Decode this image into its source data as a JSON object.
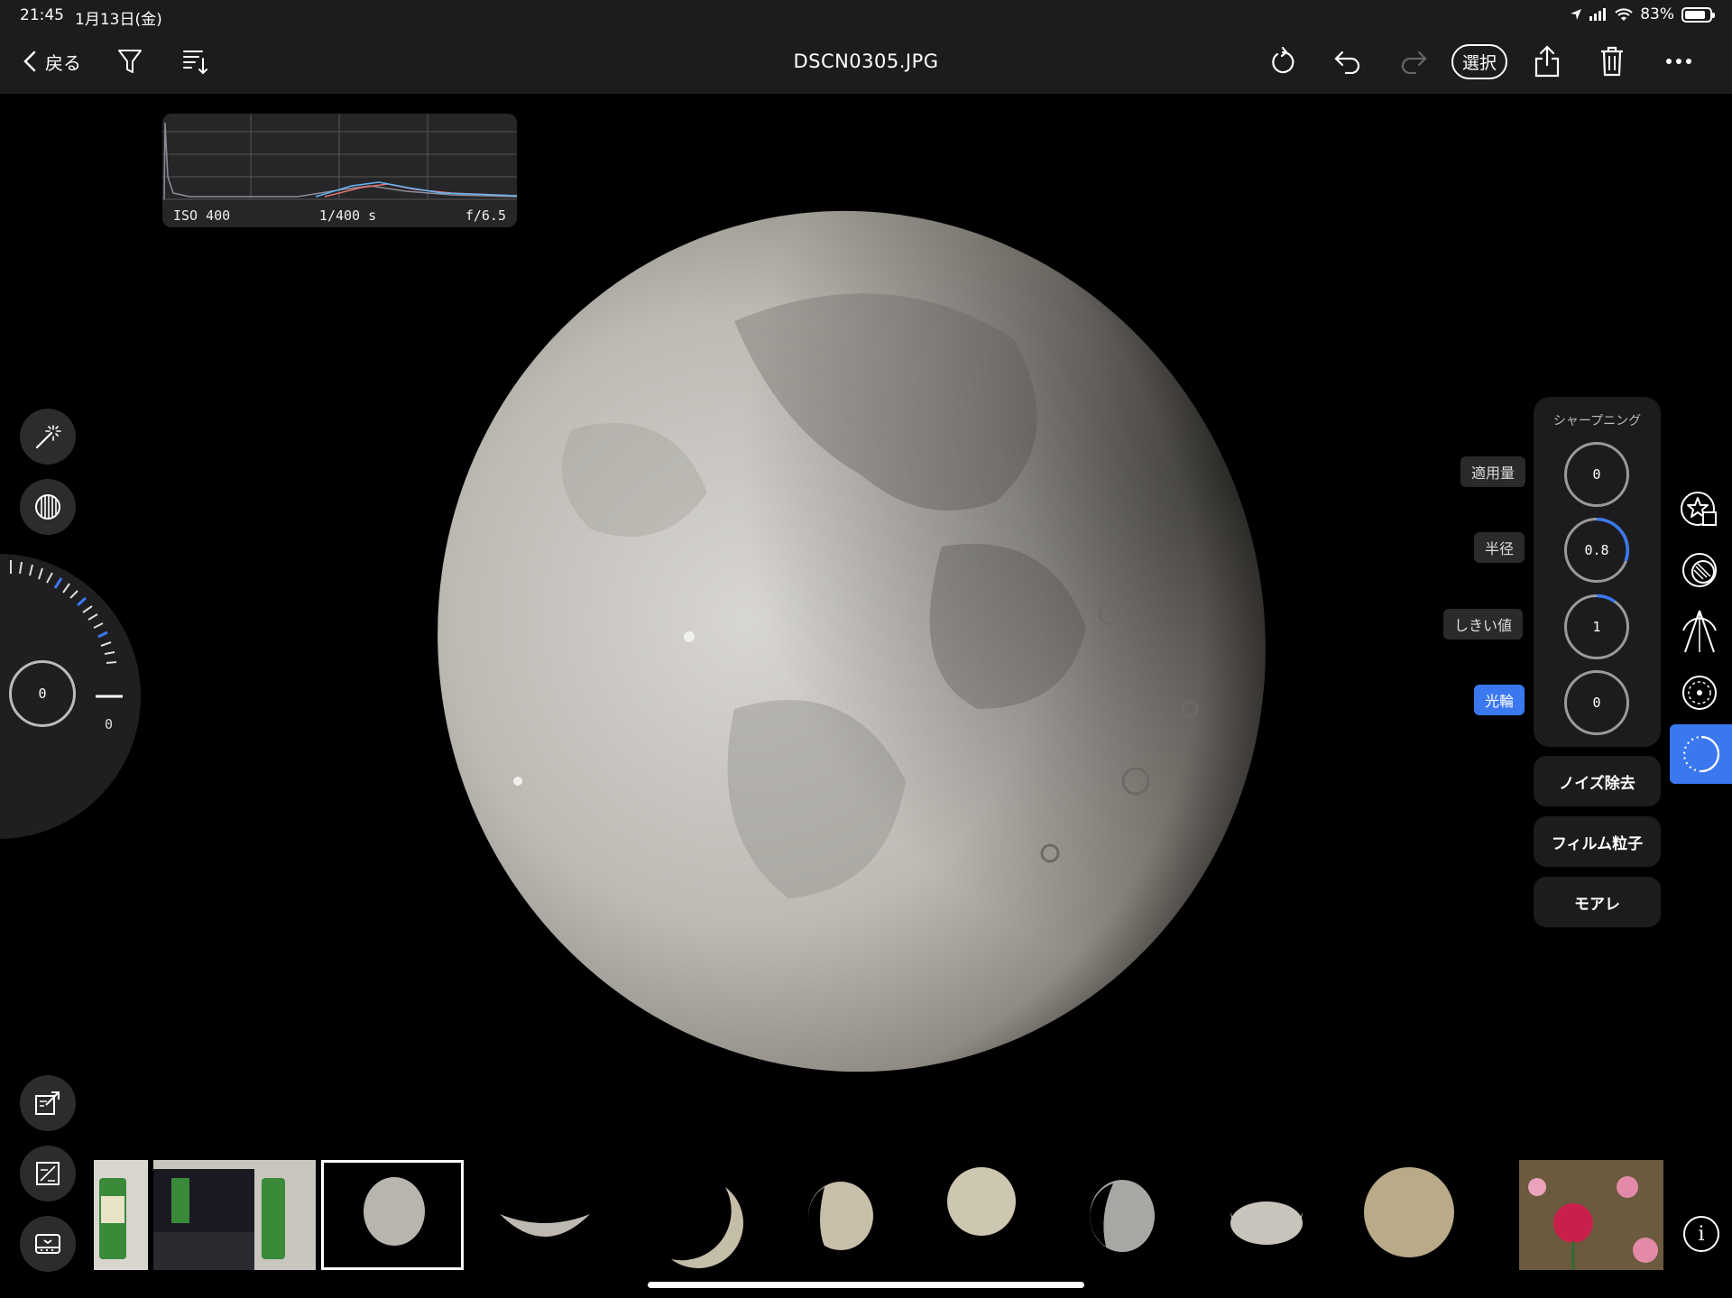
{
  "status": {
    "time": "21:45",
    "date": "1月13日(金)",
    "battery_text": "83%",
    "battery_level": 0.83
  },
  "toolbar": {
    "back_label": "戻る",
    "title": "DSCN0305.JPG",
    "select_label": "選択"
  },
  "histogram": {
    "iso": "ISO 400",
    "shutter": "1/400 s",
    "aperture": "f/6.5"
  },
  "dial": {
    "value": "0",
    "scale_zero": "0"
  },
  "sharpening": {
    "title": "シャープニング",
    "controls": [
      {
        "label": "適用量",
        "value": "0",
        "level": 0,
        "active": false
      },
      {
        "label": "半径",
        "value": "0.8",
        "level": 0.3,
        "active": false
      },
      {
        "label": "しきい値",
        "value": "1",
        "level": 0.1,
        "active": false
      },
      {
        "label": "光輪",
        "value": "0",
        "level": 0,
        "active": true
      }
    ]
  },
  "panels": {
    "noise": "ノイズ除去",
    "grain": "フィルム粒子",
    "moire": "モアレ"
  },
  "icons": {
    "filter": "filter-icon",
    "sort": "sort-icon",
    "rotate": "rotate-icon",
    "undo": "undo-icon",
    "redo": "redo-icon",
    "share": "share-icon",
    "trash": "trash-icon",
    "more": "more-icon"
  },
  "colors": {
    "accent": "#3b78f0",
    "panel": "#1c1c1e",
    "button": "#2c2c2e"
  }
}
